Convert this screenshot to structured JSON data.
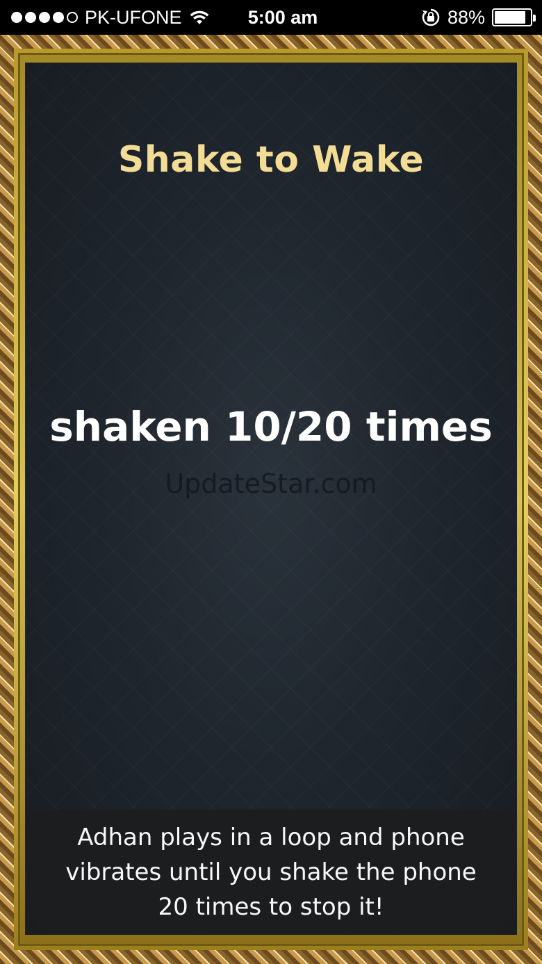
{
  "status_bar": {
    "carrier": "PK-UFONE",
    "time": "5:00 am",
    "battery_percent": "88%",
    "battery_level": 0.88,
    "signal_bars_filled": 4,
    "signal_bars_total": 5
  },
  "main": {
    "title": "Shake to Wake",
    "counter": "shaken 10/20 times",
    "watermark": "UpdateStar.com",
    "info": "Adhan plays in a loop and phone vibrates until you shake the phone 20 times to stop it!"
  },
  "colors": {
    "title": "#f3dd95",
    "background": "#1f262e",
    "frame_gold": "#d8c252"
  }
}
